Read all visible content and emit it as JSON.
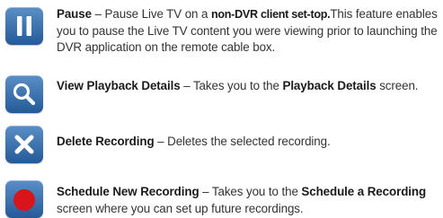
{
  "items": [
    {
      "icon": "pause-icon",
      "parts": [
        {
          "t": "Pause",
          "b": true
        },
        {
          "t": " – Pause Live TV on a ",
          "b": false
        },
        {
          "t": "non-DVR client set-top.",
          "b": true
        },
        {
          "t": "This feature enables you to pause the Live TV content you were viewing prior to launching the DVR application on the remote cable box.",
          "b": false
        }
      ]
    },
    {
      "icon": "search-icon",
      "parts": [
        {
          "t": "View Playback Details",
          "b": true
        },
        {
          "t": " – Takes you to the ",
          "b": false
        },
        {
          "t": "Playback Details",
          "b": true
        },
        {
          "t": " screen.",
          "b": false
        }
      ]
    },
    {
      "icon": "close-icon",
      "parts": [
        {
          "t": "Delete Recording",
          "b": true
        },
        {
          "t": " – Deletes the selected recording.",
          "b": false
        }
      ]
    },
    {
      "icon": "record-icon",
      "parts": [
        {
          "t": "Schedule New Recording",
          "b": true
        },
        {
          "t": " – Takes you to the ",
          "b": false
        },
        {
          "t": "Schedule a Recording",
          "b": true
        },
        {
          "t": " screen where you can set up future recordings.",
          "b": false
        }
      ]
    }
  ]
}
